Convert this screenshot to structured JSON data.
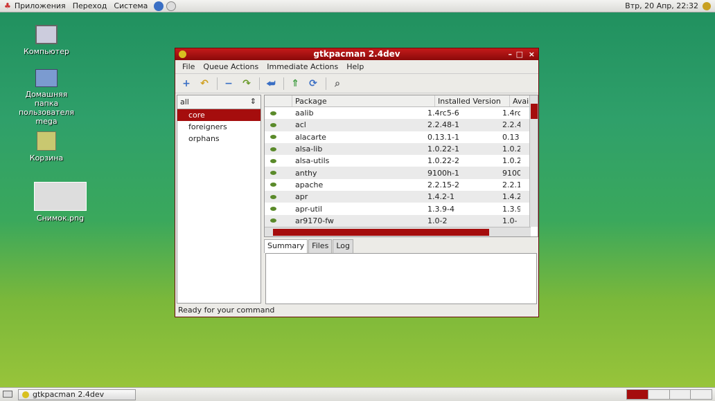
{
  "top_panel": {
    "menus": [
      "Приложения",
      "Переход",
      "Система"
    ],
    "clock": "Втр, 20 Апр, 22:32"
  },
  "desktop_icons": [
    {
      "label": "Компьютер"
    },
    {
      "label": "Домашняя папка пользователя mega"
    },
    {
      "label": "Корзина"
    },
    {
      "label": "Снимок.png"
    }
  ],
  "window": {
    "title": "gtkpacman 2.4dev",
    "menu": [
      "File",
      "Queue Actions",
      "Immediate Actions",
      "Help"
    ],
    "repo_filter": "all",
    "repos": [
      "core",
      "foreigners",
      "orphans"
    ],
    "columns": [
      "Package",
      "Installed Version",
      "Avai"
    ],
    "packages": [
      {
        "name": "aalib",
        "installed": "1.4rc5-6",
        "avail": "1.4rc"
      },
      {
        "name": "acl",
        "installed": "2.2.48-1",
        "avail": "2.2.4"
      },
      {
        "name": "alacarte",
        "installed": "0.13.1-1",
        "avail": "0.13"
      },
      {
        "name": "alsa-lib",
        "installed": "1.0.22-1",
        "avail": "1.0.2"
      },
      {
        "name": "alsa-utils",
        "installed": "1.0.22-2",
        "avail": "1.0.2"
      },
      {
        "name": "anthy",
        "installed": "9100h-1",
        "avail": "9100"
      },
      {
        "name": "apache",
        "installed": "2.2.15-2",
        "avail": "2.2.1"
      },
      {
        "name": "apr",
        "installed": "1.4.2-1",
        "avail": "1.4.2"
      },
      {
        "name": "apr-util",
        "installed": "1.3.9-4",
        "avail": "1.3.9"
      },
      {
        "name": "ar9170-fw",
        "installed": "1.0-2",
        "avail": "1.0-"
      }
    ],
    "tabs": [
      "Summary",
      "Files",
      "Log"
    ],
    "status": "Ready for your command"
  },
  "taskbar": {
    "item": "gtkpacman 2.4dev"
  }
}
